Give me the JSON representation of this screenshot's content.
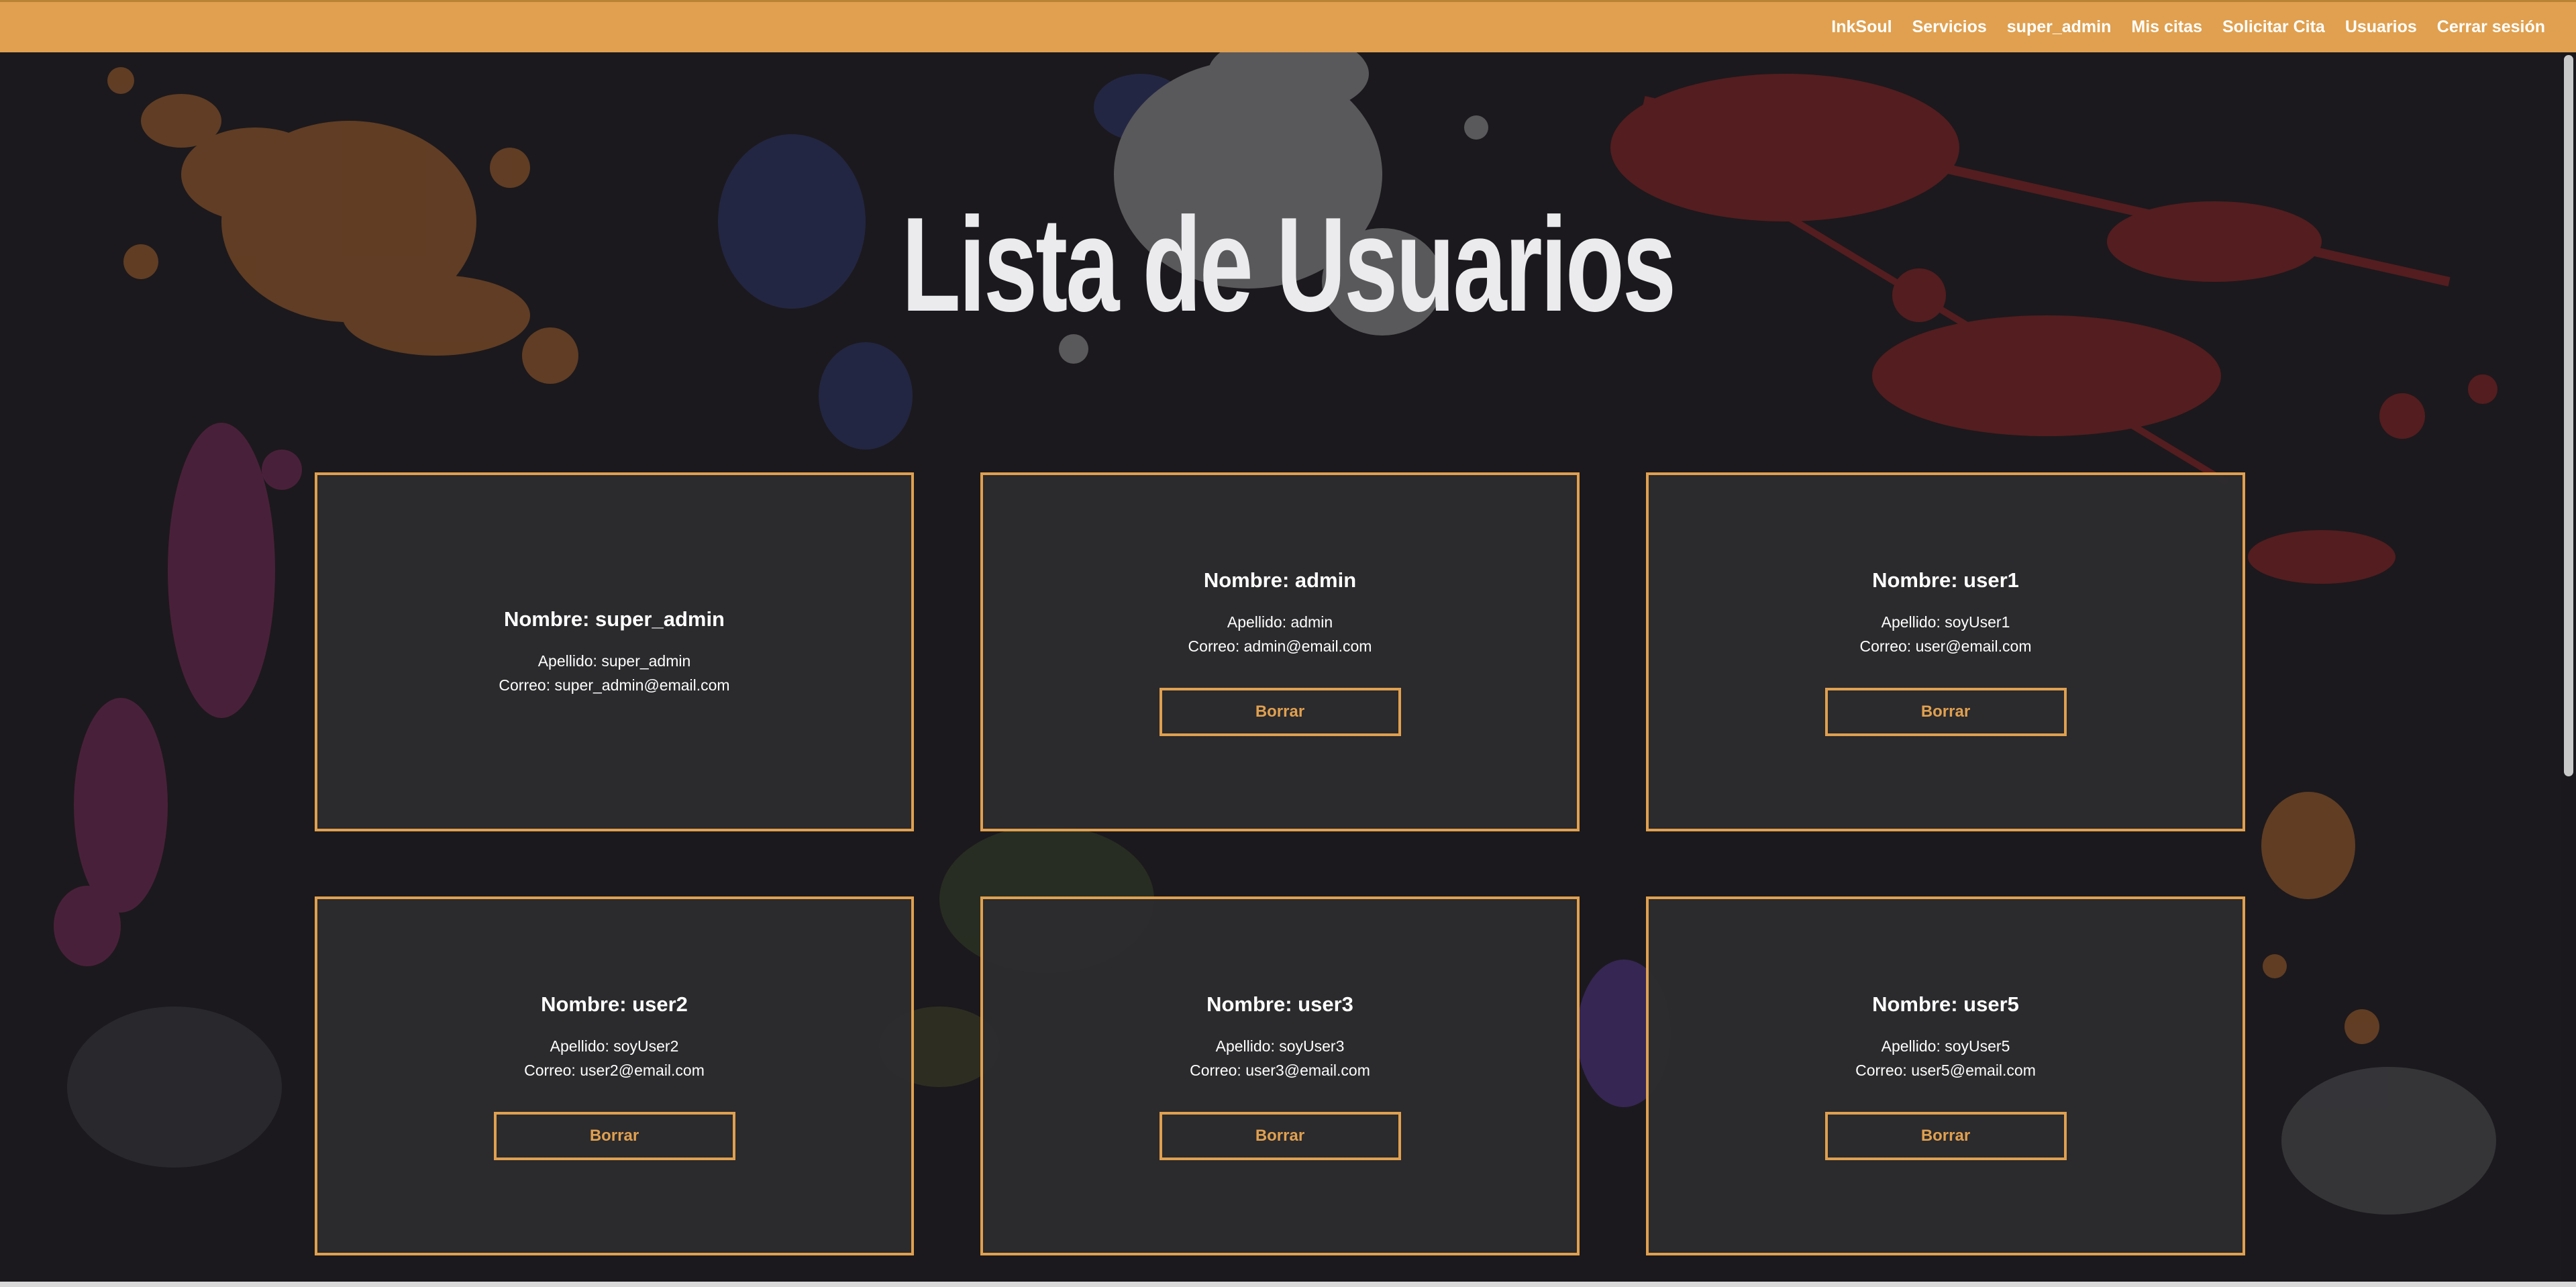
{
  "nav": {
    "brand": "InkSoul",
    "items": [
      "Servicios",
      "super_admin",
      "Mis citas",
      "Solicitar Cita",
      "Usuarios",
      "Cerrar sesión"
    ]
  },
  "page_title": "Lista de Usuarios",
  "users": [
    {
      "name": "Nombre: super_admin",
      "apellido": "Apellido: super_admin",
      "correo": "Correo: super_admin@email.com",
      "delete_label": ""
    },
    {
      "name": "Nombre: admin",
      "apellido": "Apellido: admin",
      "correo": "Correo: admin@email.com",
      "delete_label": "Borrar"
    },
    {
      "name": "Nombre: user1",
      "apellido": "Apellido: soyUser1",
      "correo": "Correo: user@email.com",
      "delete_label": "Borrar"
    },
    {
      "name": "Nombre: user2",
      "apellido": "Apellido: soyUser2",
      "correo": "Correo: user2@email.com",
      "delete_label": "Borrar"
    },
    {
      "name": "Nombre: user3",
      "apellido": "Apellido: soyUser3",
      "correo": "Correo: user3@email.com",
      "delete_label": "Borrar"
    },
    {
      "name": "Nombre: user5",
      "apellido": "Apellido: soyUser5",
      "correo": "Correo: user5@email.com",
      "delete_label": "Borrar"
    }
  ],
  "colors": {
    "accent": "#e0a04f",
    "background": "#1b191d",
    "card": "#2c2b2d",
    "text": "#ffffff"
  }
}
